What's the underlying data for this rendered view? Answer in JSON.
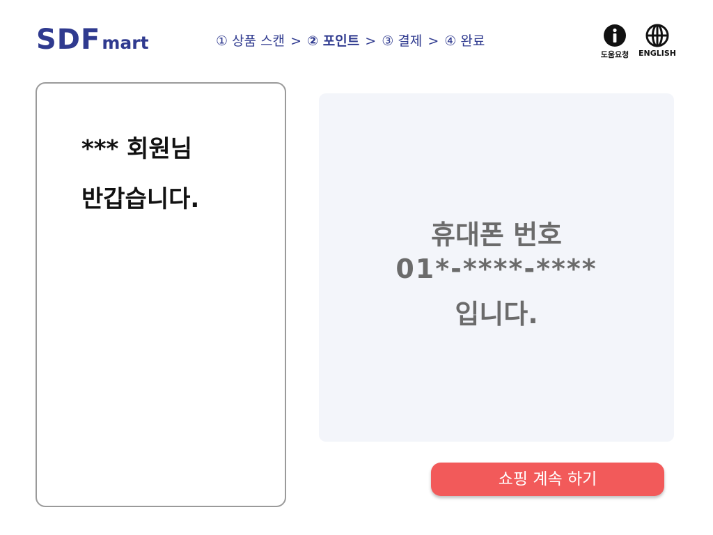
{
  "logo": {
    "main": "SDF",
    "sub": "mart"
  },
  "steps": [
    {
      "label": "① 상품 스캔",
      "active": false
    },
    {
      "label": "② 포인트",
      "active": true
    },
    {
      "label": "③ 결제",
      "active": false
    },
    {
      "label": "④ 완료",
      "active": false
    }
  ],
  "step_separator": ">",
  "top_icons": {
    "help": {
      "icon": "info-icon",
      "label": "도움요청"
    },
    "language": {
      "icon": "globe-icon",
      "label": "ENGLISH"
    }
  },
  "welcome": {
    "line1": "*** 회원님",
    "line2": "반갑습니다."
  },
  "phone": {
    "title": "휴대폰 번호",
    "number": "01*-****-****",
    "suffix": "입니다."
  },
  "continue_button": "쇼핑 계속 하기",
  "colors": {
    "brand": "#2f3a8f",
    "button": "#f25a5a",
    "panel_bg": "#f3f5fa"
  }
}
